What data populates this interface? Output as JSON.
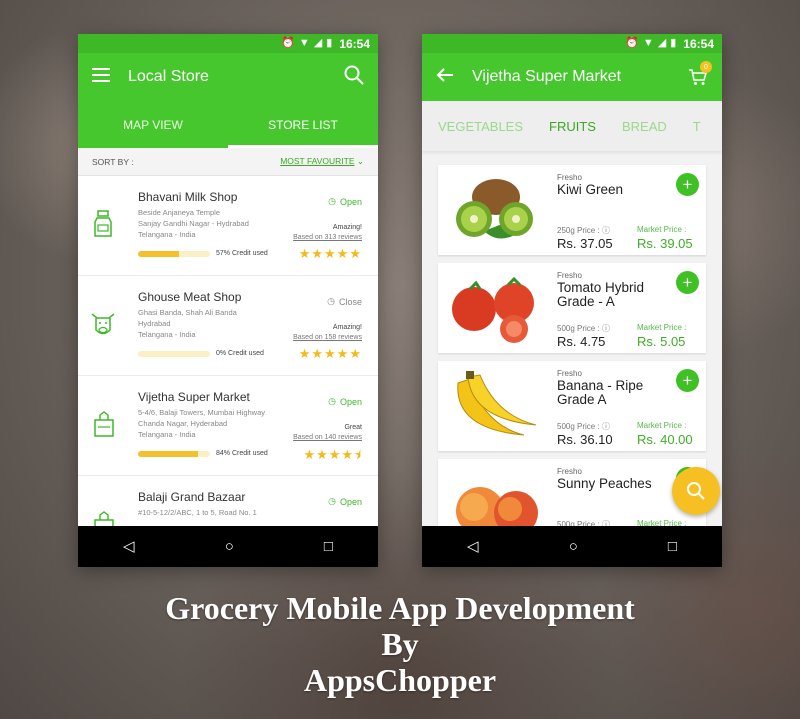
{
  "status": {
    "time": "16:54"
  },
  "screen1": {
    "title": "Local Store",
    "tabs": [
      "MAP VIEW",
      "STORE LIST"
    ],
    "sort_label": "SORT BY :",
    "sort_value": "MOST FAVOURITE",
    "stores": [
      {
        "name": "Bhavani Milk Shop",
        "addr1": "Beside Anjaneya Temple",
        "addr2": "Sanjay Gandhi Nagar - Hydrabad",
        "addr3": "Telangana - India",
        "status": "Open",
        "rating_word": "Amazing!",
        "reviews": "Based on 313 reviews",
        "credit": "57% Credit used",
        "credit_pct": 57,
        "stars": "★★★★★",
        "icon": "milk-bottle-icon"
      },
      {
        "name": "Ghouse Meat Shop",
        "addr1": "Ghasi Banda, Shah Ali Banda",
        "addr2": "Hydrabad",
        "addr3": "Telangana - India",
        "status": "Close",
        "rating_word": "Amazing!",
        "reviews": "Based on 158 reviews",
        "credit": "0% Credit used",
        "credit_pct": 0,
        "stars": "★★★★★",
        "icon": "cow-icon"
      },
      {
        "name": "Vijetha Super Market",
        "addr1": "5-4/6, Balaji Towers, Mumbai Highway",
        "addr2": "Chanda Nagar, Hyderabad",
        "addr3": "Telangana - India",
        "status": "Open",
        "rating_word": "Great",
        "reviews": "Based on 140 reviews",
        "credit": "84% Credit used",
        "credit_pct": 84,
        "stars": "★★★★⯨",
        "icon": "grocery-bag-icon"
      },
      {
        "name": "Balaji Grand Bazaar",
        "addr1": "#10-5-12/2/ABC, 1 to 5, Road No. 1",
        "addr2": "",
        "addr3": "",
        "status": "Open",
        "rating_word": "",
        "reviews": "",
        "credit": "",
        "credit_pct": 0,
        "stars": "",
        "icon": "grocery-bag-icon"
      }
    ]
  },
  "screen2": {
    "title": "Vijetha Super Market",
    "cart_count": "0",
    "categories": [
      "VEGETABLES",
      "FRUITS",
      "BREAD",
      "T"
    ],
    "products": [
      {
        "brand": "Fresho",
        "name": "Kiwi Green",
        "price_label": "250g Price :",
        "price": "Rs. 37.05",
        "market_label": "Market Price :",
        "market": "Rs. 39.05"
      },
      {
        "brand": "Fresho",
        "name": "Tomato Hybrid Grade - A",
        "price_label": "500g Price :",
        "price": "Rs. 4.75",
        "market_label": "Market Price :",
        "market": "Rs. 5.05"
      },
      {
        "brand": "Fresho",
        "name": "Banana - Ripe Grade A",
        "price_label": "500g Price :",
        "price": "Rs. 36.10",
        "market_label": "Market Price :",
        "market": "Rs. 40.00"
      },
      {
        "brand": "Fresho",
        "name": "Sunny Peaches",
        "price_label": "500g Price :",
        "price": "",
        "market_label": "Market Price :",
        "market": ""
      }
    ]
  },
  "caption": {
    "line1": "Grocery Mobile App Development",
    "line2": "By",
    "line3": "AppsChopper"
  },
  "colors": {
    "primary_green": "#47c72e",
    "accent_yellow": "#f6c022"
  }
}
